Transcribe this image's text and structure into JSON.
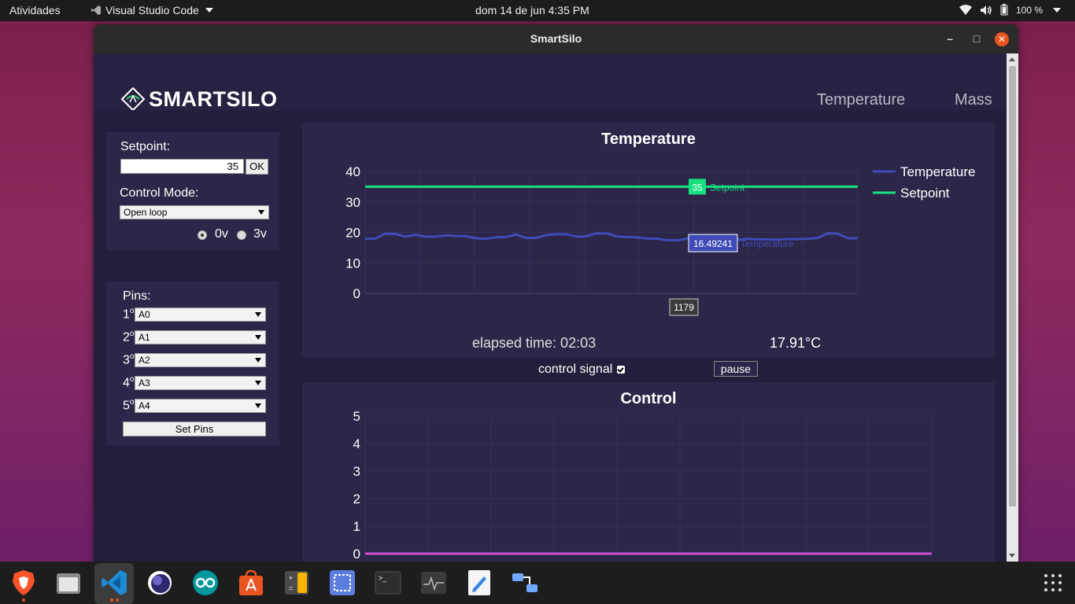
{
  "topbar": {
    "activities": "Atividades",
    "app_name": "Visual Studio Code",
    "clock": "dom 14 de jun   4:35 PM",
    "battery": "100 %"
  },
  "window": {
    "title": "SmartSilo"
  },
  "app": {
    "logo_text": "SMARTSILO",
    "nav": [
      "Temperature",
      "Mass"
    ]
  },
  "controls": {
    "setpoint_label": "Setpoint:",
    "setpoint_value": "35",
    "ok_label": "OK",
    "control_mode_label": "Control Mode:",
    "control_mode_value": "Open loop",
    "radio_options": [
      "0v",
      "3v"
    ],
    "radio_selected": "0v"
  },
  "pins": {
    "label": "Pins:",
    "items": [
      {
        "num": "1",
        "sup": "o",
        "value": "A0"
      },
      {
        "num": "2",
        "sup": "o",
        "value": "A1"
      },
      {
        "num": "3",
        "sup": "o",
        "value": "A2"
      },
      {
        "num": "4",
        "sup": "o",
        "value": "A3"
      },
      {
        "num": "5",
        "sup": "o",
        "value": "A4"
      }
    ],
    "set_pins_label": "Set Pins"
  },
  "temperature_panel": {
    "elapsed": "elapsed time: 02:03",
    "reading": "17.91°C",
    "control_signal_label": "control signal",
    "pause_label": "pause",
    "hover_x_label": "1179",
    "hover_setpoint_value": "35",
    "hover_setpoint_name": "Setpoint",
    "hover_temp_value": "16.49241",
    "hover_temp_name": "Temperature"
  },
  "chart_data": [
    {
      "type": "line",
      "title": "Temperature",
      "ylim": [
        0,
        40
      ],
      "yticks": [
        0,
        10,
        20,
        30,
        40
      ],
      "grid": true,
      "legend": "top-right",
      "series": [
        {
          "name": "Temperature",
          "color": "#3f4bb8",
          "values": [
            17.9,
            18.0,
            19.6,
            19.5,
            18.6,
            19.2,
            18.6,
            18.6,
            19.0,
            18.8,
            18.8,
            18.1,
            17.9,
            18.4,
            18.5,
            19.3,
            18.2,
            18.2,
            19.1,
            19.4,
            19.4,
            18.6,
            18.7,
            19.7,
            19.7,
            18.7,
            18.5,
            18.4,
            18.0,
            17.9,
            17.5,
            17.4,
            17.9,
            17.8,
            16.5,
            16.5,
            16.5,
            17.5,
            17.9,
            17.7,
            17.7,
            17.6,
            17.8,
            17.8,
            17.9,
            18.2,
            19.7,
            19.6,
            18.1,
            18.1
          ]
        },
        {
          "name": "Setpoint",
          "color": "#16e07f",
          "values": [
            35,
            35,
            35,
            35,
            35,
            35,
            35,
            35,
            35,
            35,
            35,
            35,
            35,
            35,
            35,
            35,
            35,
            35,
            35,
            35,
            35,
            35,
            35,
            35,
            35,
            35,
            35,
            35,
            35,
            35,
            35,
            35,
            35,
            35,
            35,
            35,
            35,
            35,
            35,
            35,
            35,
            35,
            35,
            35,
            35,
            35,
            35,
            35,
            35,
            35
          ]
        }
      ]
    },
    {
      "type": "line",
      "title": "Control",
      "ylim": [
        0,
        5
      ],
      "yticks": [
        0,
        1,
        2,
        3,
        4,
        5
      ],
      "grid": true,
      "series": [
        {
          "color": "#d44fd6",
          "values": [
            0,
            0,
            0,
            0,
            0,
            0,
            0,
            0,
            0,
            0,
            0,
            0,
            0,
            0,
            0,
            0,
            0,
            0,
            0,
            0,
            0,
            0,
            0,
            0,
            0,
            0,
            0,
            0,
            0,
            0,
            0,
            0,
            0,
            0,
            0,
            0,
            0,
            0,
            0,
            0,
            0,
            0,
            0,
            0,
            0,
            0,
            0,
            0,
            0,
            0
          ]
        }
      ]
    }
  ]
}
